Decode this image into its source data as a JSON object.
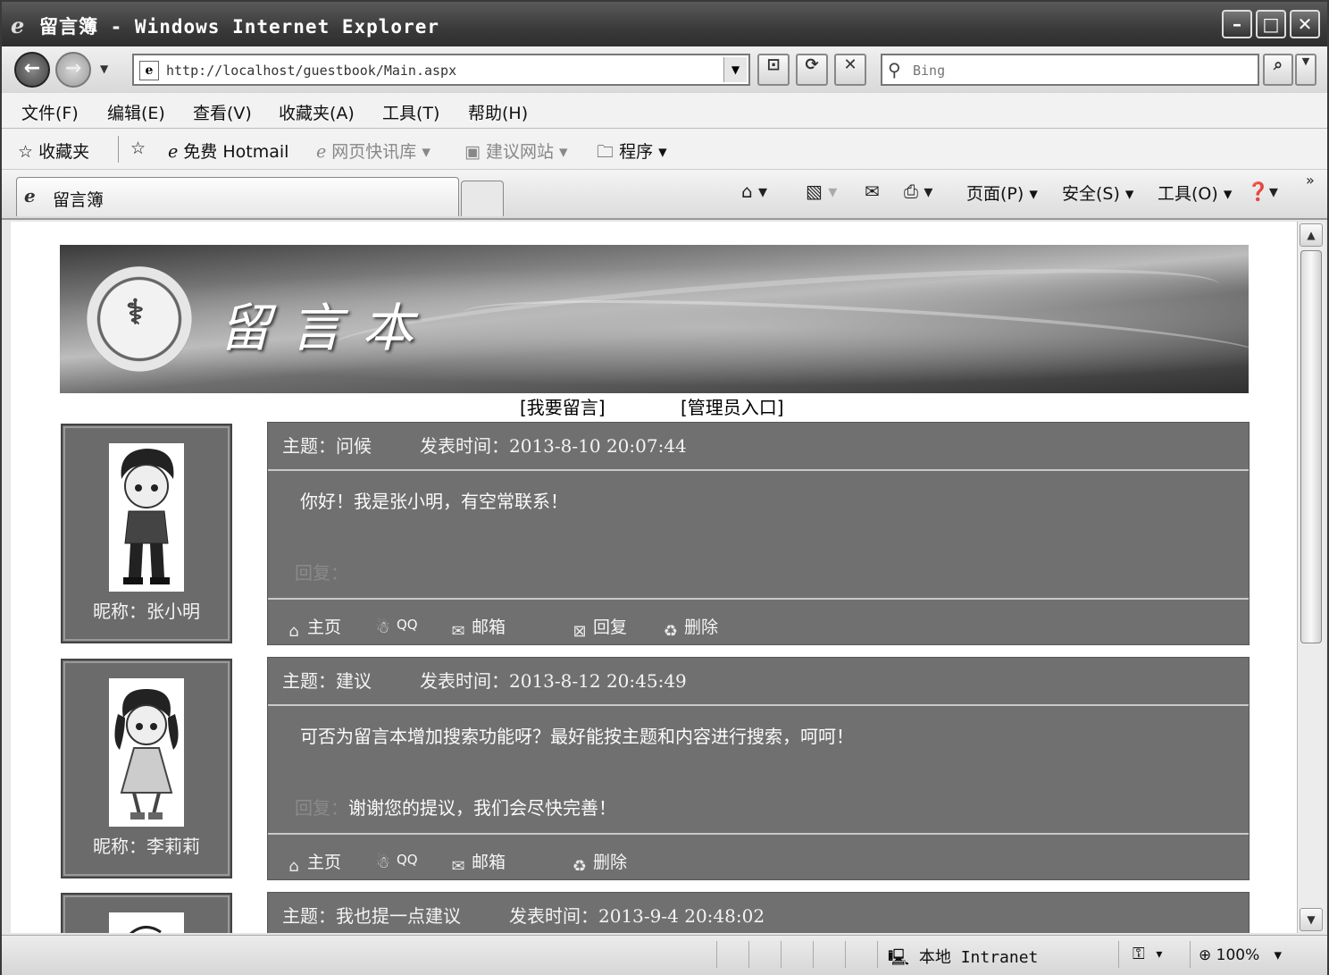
{
  "window": {
    "title": "留言簿 - Windows Internet Explorer"
  },
  "address": {
    "url": "http://localhost/guestbook/Main.aspx",
    "search_placeholder": "Bing"
  },
  "menu": [
    "文件(F)",
    "编辑(E)",
    "查看(V)",
    "收藏夹(A)",
    "工具(T)",
    "帮助(H)"
  ],
  "favorites": {
    "label": "收藏夹",
    "items": [
      "免费 Hotmail",
      "网页快讯库 ▾",
      "建议网站 ▾",
      "程序 ▾"
    ]
  },
  "tab": {
    "title": "留言簿"
  },
  "commandbar": {
    "page": "页面(P) ▾",
    "safety": "安全(S) ▾",
    "tools": "工具(O) ▾"
  },
  "status": {
    "zone": "本地 Intranet",
    "zoom": "100%"
  },
  "site": {
    "banner_title": "留言本",
    "links": {
      "post": "[我要留言]",
      "admin": "[管理员入口]"
    }
  },
  "entries": [
    {
      "nickname": "昵称：张小明",
      "subject_label": "主题：问候",
      "time_label": "发表时间：2013-8-10 20:07:44",
      "content": "你好！我是张小明，有空常联系！",
      "reply_label": "回复：",
      "reply": "",
      "actions": [
        "主页",
        "QQ",
        "邮箱",
        "回复",
        "删除"
      ]
    },
    {
      "nickname": "昵称：李莉莉",
      "subject_label": "主题：建议",
      "time_label": "发表时间：2013-8-12 20:45:49",
      "content": "可否为留言本增加搜索功能呀？最好能按主题和内容进行搜索，呵呵！",
      "reply_label": "回复：",
      "reply": "谢谢您的提议，我们会尽快完善！",
      "actions": [
        "主页",
        "QQ",
        "邮箱",
        "删除"
      ]
    },
    {
      "subject_label": "主题：我也提一点建议",
      "time_label": "发表时间：2013-9-4 20:48:02"
    }
  ]
}
